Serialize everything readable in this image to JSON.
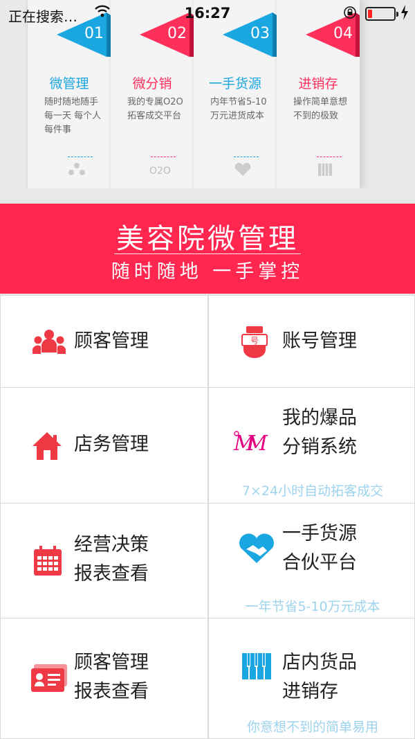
{
  "status_bar": {
    "carrier": "正在搜索…",
    "time": "16:27"
  },
  "banner": {
    "cards": [
      {
        "num": "01",
        "title": "微管理",
        "desc": "随时随地随手 每一天 每个人每件事",
        "icon": "people-network-icon",
        "color": "#1aa6e0"
      },
      {
        "num": "02",
        "title": "微分销",
        "desc": "我的专属O2O 拓客成交平台",
        "icon": "o2o-icon",
        "color": "#ff2f5c"
      },
      {
        "num": "03",
        "title": "一手货源",
        "desc": "内年节省5-10 万元进货成本",
        "icon": "heart-icon",
        "color": "#1aa6e0"
      },
      {
        "num": "04",
        "title": "进销存",
        "desc": "操作简单意想 不到的极致",
        "icon": "piano-icon",
        "color": "#ff2f5c"
      }
    ]
  },
  "header": {
    "title": "美容院微管理",
    "subtitle": "随时随地  一手掌控"
  },
  "menu": {
    "customer_mgmt": {
      "label": "顾客管理",
      "icon": "people-icon"
    },
    "account_mgmt": {
      "label": "账号管理",
      "icon": "account-badge-icon"
    },
    "store_mgmt": {
      "label": "店务管理",
      "icon": "house-icon"
    },
    "distribution": {
      "line1": "我的爆品",
      "line2": "分销系统",
      "sub": "7×24小时自动拓客成交",
      "icon": "mm-logo-icon"
    },
    "business_report": {
      "line1": "经营决策",
      "line2": "报表查看",
      "icon": "calendar-icon"
    },
    "supply": {
      "line1": "一手货源",
      "line2": "合伙平台",
      "sub": "一年节省5-10万元成本",
      "icon": "handshake-heart-icon"
    },
    "customer_report": {
      "line1": "顾客管理",
      "line2": "报表查看",
      "icon": "id-card-icon"
    },
    "inventory": {
      "line1": "店内货品",
      "line2": "进销存",
      "sub": "你意想不到的简单易用",
      "icon": "piano-keys-icon"
    }
  },
  "colors": {
    "accent_red": "#ff2650",
    "icon_red": "#ef3a45",
    "icon_blue": "#1aa6e0",
    "sub_text": "#9ed3ee"
  }
}
